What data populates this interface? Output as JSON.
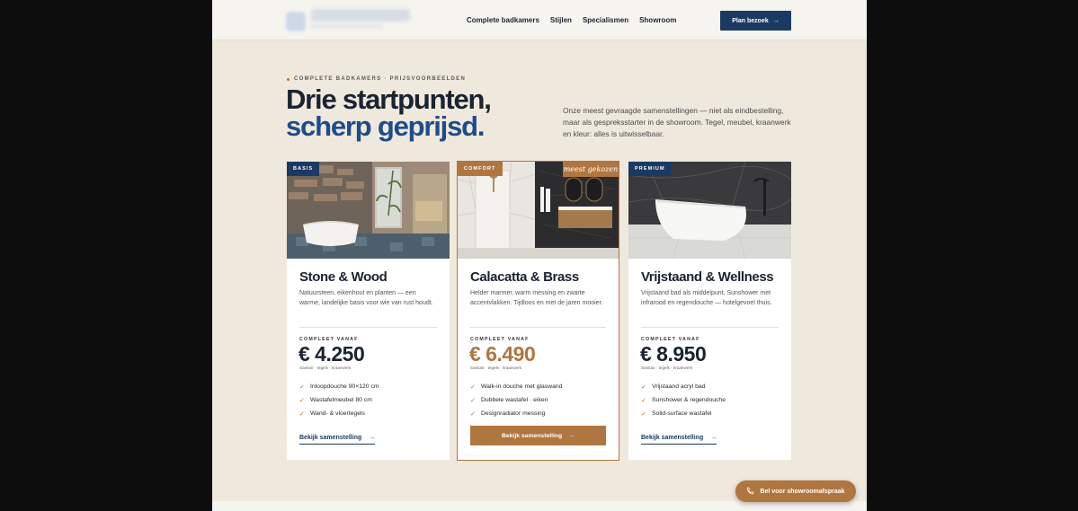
{
  "nav": {
    "links": [
      "Complete badkamers",
      "Stijlen",
      "Specialismen",
      "Showroom"
    ],
    "cta_label": "Plan bezoek",
    "cta_icon": "arrow-right-icon"
  },
  "hero": {
    "eyebrow": "COMPLETE BADKAMERS · PRIJSVOORBEELDEN",
    "title_line1": "Drie startpunten,",
    "title_line2": "scherp geprijsd.",
    "intro": "Onze meest gevraagde samenstellingen — niet als eindbestelling, maar als gespreksstarter in de showroom. Tegel, meubel, kraanwerk en kleur: alles is uitwisselbaar."
  },
  "cards": [
    {
      "tag": "BASIS",
      "tag_color": "#1b3a63",
      "title": "Stone & Wood",
      "description": "Natuursteen, eikenhout en planten — een warme, landelijke basis voor wie van rust houdt.",
      "price_label": "COMPLEET VANAF",
      "price": "€ 4.250",
      "price_note": "Sanitair · tegels · kraanwerk",
      "features": [
        "Inloopdouche 90×120 cm",
        "Wastafelmeubel 80 cm",
        "Wand- & vloertegels"
      ],
      "link_label": "Bekijk samenstelling"
    },
    {
      "tag": "COMFORT",
      "tag_color": "#b07640",
      "ribbon": "meest gekozen",
      "title": "Calacatta & Brass",
      "description": "Helder marmer, warm messing en zwarte accentvlakken. Tijdloos en met de jaren mooier.",
      "price_label": "COMPLEET VANAF",
      "price": "€ 6.490",
      "price_note": "Sanitair · tegels · kraanwerk",
      "features": [
        "Walk-in douche met glaswand",
        "Dubbele wastafel · eiken",
        "Designradiator messing"
      ],
      "link_label": "Bekijk samenstelling"
    },
    {
      "tag": "PREMIUM",
      "tag_color": "#1b3a63",
      "title": "Vrijstaand & Wellness",
      "description": "Vrijstaand bad als middelpunt, Sunshower met infrarood en regendouche — hotelgevoel thuis.",
      "price_label": "COMPLEET VANAF",
      "price": "€ 8.950",
      "price_note": "Sanitair · tegels · kraanwerk",
      "features": [
        "Vrijstaand acryl bad",
        "Sunshower & regendouche",
        "Solid-surface wastafel"
      ],
      "link_label": "Bekijk samenstelling"
    }
  ],
  "floating_cta": {
    "label": "Bel voor showroomafspraak",
    "icon": "phone-icon"
  },
  "colors": {
    "brand_navy": "#1b3a63",
    "brand_blue": "#1f4c8a",
    "accent_copper": "#b07640",
    "page_bg": "#efe9dd"
  }
}
